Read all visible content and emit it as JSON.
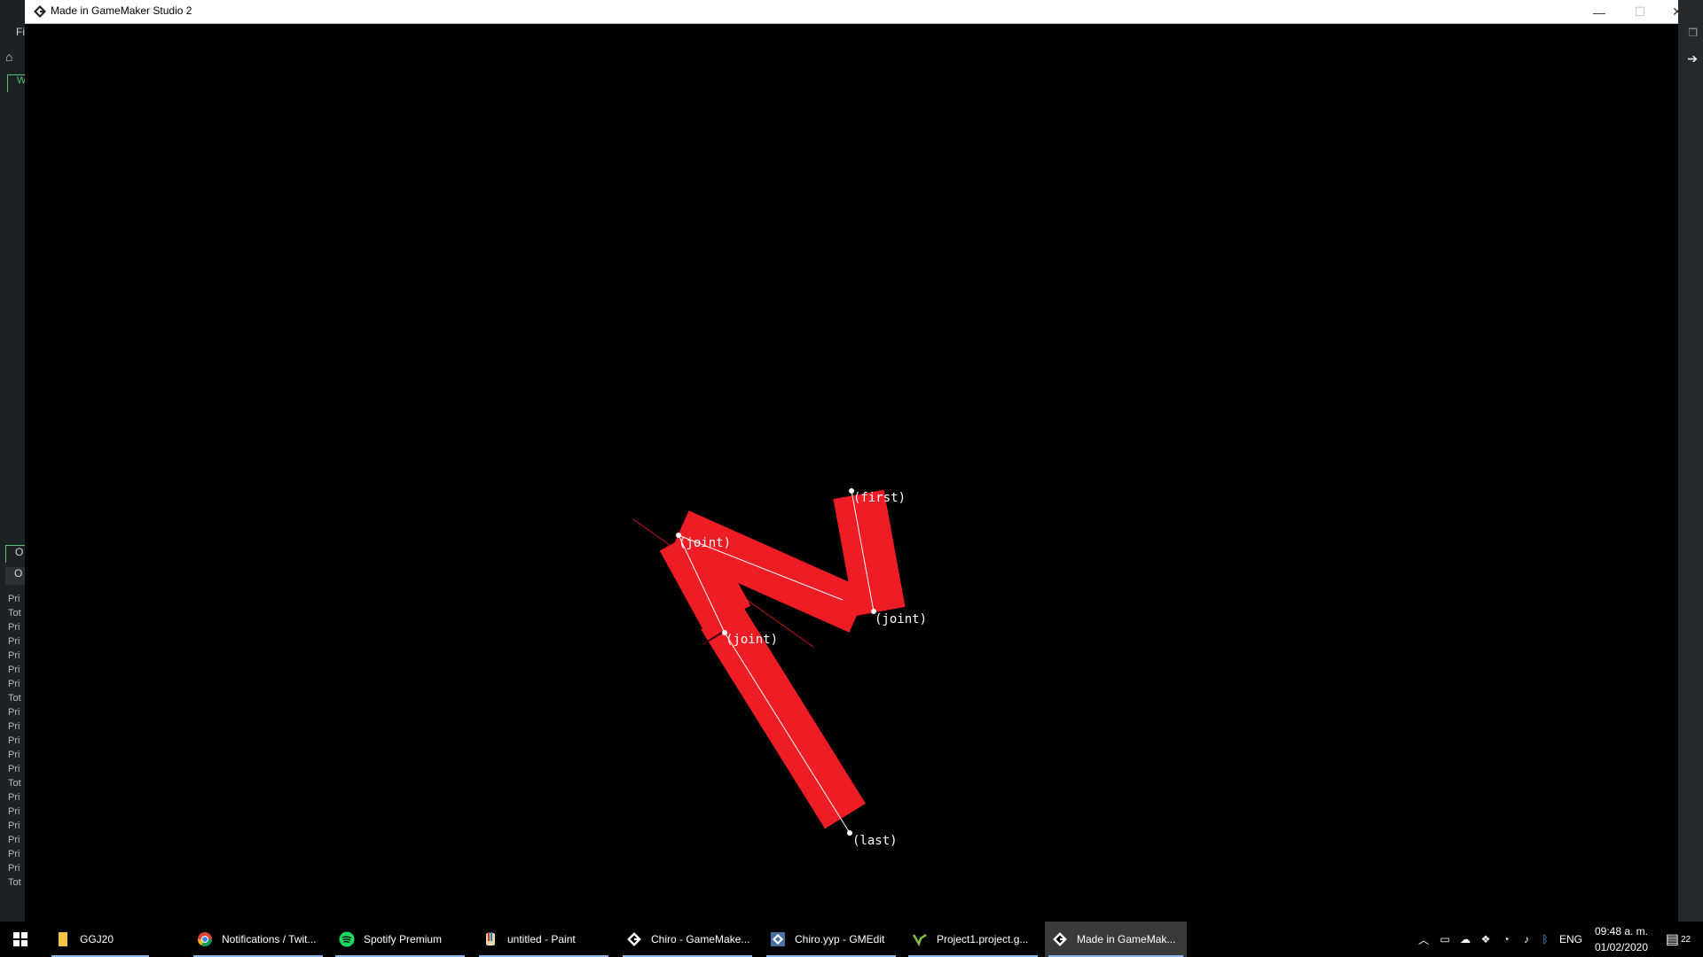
{
  "window": {
    "title": "Made in GameMaker Studio 2",
    "minimize_icon": "minimize-icon",
    "maximize_icon": "maximize-icon",
    "close_icon": "close-icon"
  },
  "background_ide": {
    "menu_fragment": "Fi",
    "tab_fragment": "W",
    "output_tab_fragment": "O",
    "output_subtab_fragment": "O",
    "log_fragments": [
      "Pri",
      "Tot",
      "Pri",
      "Pri",
      "Pri",
      "Pri",
      "Pri",
      "Tot",
      "Pri",
      "Pri",
      "Pri",
      "Pri",
      "Pri",
      "Tot",
      "Pri",
      "Pri",
      "Pri",
      "Pri",
      "Pri",
      "Pri",
      "Tot"
    ]
  },
  "game": {
    "labels": {
      "first": "(first)",
      "joint1": "(joint)",
      "joint2": "(joint)",
      "joint3": "(joint)",
      "last": "(last)"
    },
    "colors": {
      "segment": "#ee1c25",
      "bone_line": "#ffffff",
      "debug_line": "#c0151c",
      "background": "#000000"
    }
  },
  "taskbar": {
    "items": [
      {
        "label": "GGJ20",
        "icon": "folder-icon"
      },
      {
        "label": "Notifications / Twit...",
        "icon": "chrome-icon"
      },
      {
        "label": "Spotify Premium",
        "icon": "spotify-icon"
      },
      {
        "label": "untitled - Paint",
        "icon": "paint-icon"
      },
      {
        "label": "Chiro - GameMake...",
        "icon": "gamemaker-icon"
      },
      {
        "label": "Chiro.yyp - GMEdit",
        "icon": "gmedit-icon"
      },
      {
        "label": "Project1.project.g...",
        "icon": "project-icon"
      },
      {
        "label": "Made in GameMak...",
        "icon": "gamemaker-icon"
      }
    ],
    "tray": {
      "language": "ENG",
      "time": "09:48 a. m.",
      "date": "01/02/2020",
      "notifications": "22"
    }
  }
}
